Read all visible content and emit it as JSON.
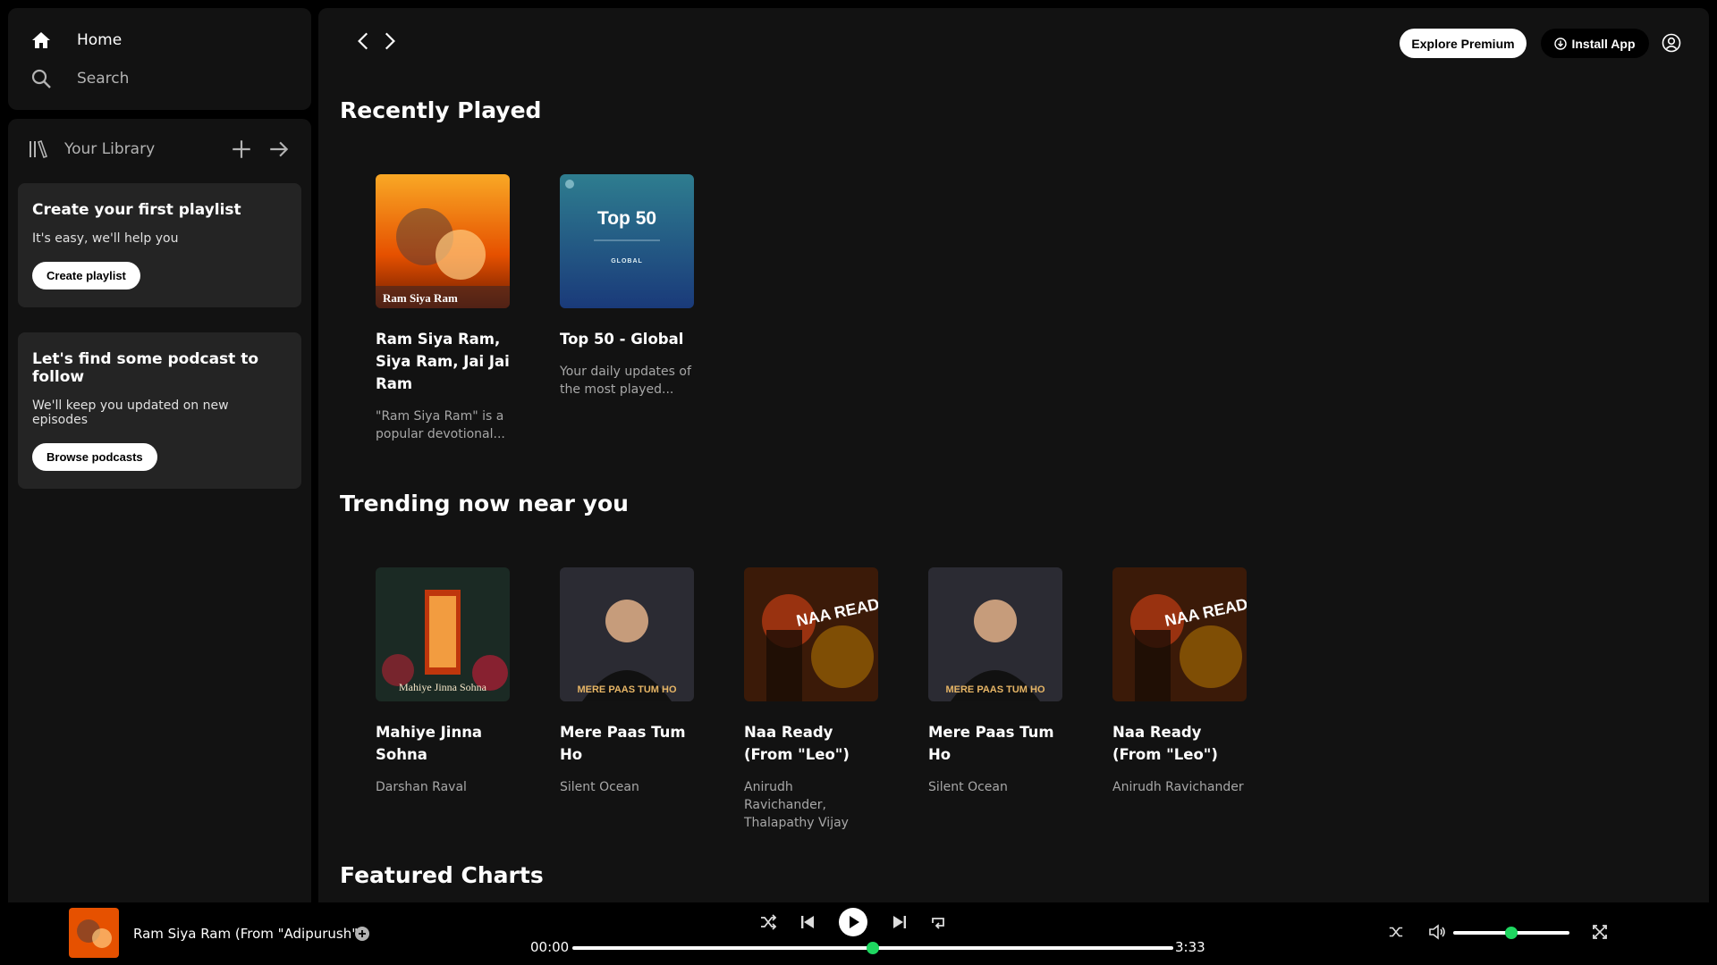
{
  "sidebar": {
    "nav": {
      "home": "Home",
      "search": "Search"
    },
    "library": {
      "label": "Your Library",
      "playlist_card": {
        "title": "Create your first playlist",
        "subtitle": "It's easy, we'll help you",
        "button": "Create playlist"
      },
      "podcast_card": {
        "title": "Let's find some podcast to follow",
        "subtitle": "We'll keep you updated on new episodes",
        "button": "Browse podcasts"
      }
    }
  },
  "topbar": {
    "premium": "Explore Premium",
    "install": "Install App"
  },
  "sections": {
    "recent": {
      "title": "Recently Played",
      "items": [
        {
          "title": "Ram Siya Ram, Siya Ram, Jai Jai Ram",
          "subtitle": "\"Ram Siya Ram\" is a popular devotional...",
          "cover_text": "Ram Siya Ram"
        },
        {
          "title": "Top 50 - Global",
          "subtitle": "Your daily updates of the most played...",
          "cover_text": "Top 50",
          "cover_sub": "GLOBAL"
        }
      ]
    },
    "trending": {
      "title": "Trending now near you",
      "items": [
        {
          "title": "Mahiye Jinna Sohna",
          "subtitle": "Darshan Raval",
          "cover_text": "Mahiye Jinna Sohna"
        },
        {
          "title": "Mere Paas Tum Ho",
          "subtitle": "Silent Ocean",
          "cover_text": "MERE PAAS TUM HO"
        },
        {
          "title": "Naa Ready (From \"Leo\")",
          "subtitle": "Anirudh Ravichander, Thalapathy Vijay",
          "cover_text": "NAA READY"
        },
        {
          "title": "Mere Paas Tum Ho",
          "subtitle": "Silent Ocean",
          "cover_text": "MERE PAAS TUM HO"
        },
        {
          "title": "Naa Ready (From \"Leo\")",
          "subtitle": "Anirudh Ravichander",
          "cover_text": "NAA READY"
        }
      ]
    },
    "charts": {
      "title": "Featured Charts"
    }
  },
  "player": {
    "track_title": "Ram Siya Ram (From \"Adipurush\")",
    "elapsed": "00:00",
    "duration": "3:33",
    "progress_fraction": 0.5,
    "volume_fraction": 0.5
  },
  "colors": {
    "accent": "#1ed760",
    "panel": "#121212",
    "card": "#242424"
  }
}
